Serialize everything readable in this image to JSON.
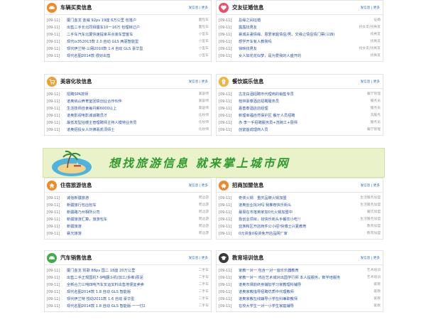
{
  "more_label": "发信息 | 更多",
  "panels": {
    "cars": {
      "title": "车辆买卖信息",
      "items": [
        {
          "date": "[09-11]",
          "title": "厦门金龙 金威 92ps 19座 6万公里 包落户",
          "tag": "面包车"
        },
        {
          "date": "[09-11]",
          "title": "出售二手长北同拜疆车10一16万 包理转过户",
          "tag": "面包车"
        },
        {
          "date": "[09-11]",
          "title": "二手车汽车北厦快速提拿吊点装车营客车",
          "tag": "小型车"
        },
        {
          "date": "[09-11]",
          "title": "现代ix352013款 2.0 自动 GLS 两驱智能型",
          "tag": "小型车"
        },
        {
          "date": "[09-11]",
          "title": "现代伊兰特-三厢2010款 1.4 自动 GLS 豪华型",
          "tag": "小型车"
        },
        {
          "date": "[09-11]",
          "title": "现代名图2014款 很好出售",
          "tag": "小型车"
        }
      ]
    },
    "dating": {
      "title": "交友征婚信息",
      "items": [
        {
          "date": "[09-11]",
          "title": "总缘之间征婚",
          "tag": "征婚"
        },
        {
          "date": "[09-11]",
          "title": "露露找男友",
          "tag": "找女友/找男友"
        },
        {
          "date": "[09-11]",
          "title": "襄城夫妻情缘、恩爱家庭情侣/男、交缘让情侣情门票(三四)",
          "tag": "找男友"
        },
        {
          "date": "[09-11]",
          "title": "想学开车有人教我吗",
          "tag": "找男友"
        },
        {
          "date": "[09-11]",
          "title": "徐映找男友",
          "tag": "找女友/找男友"
        },
        {
          "date": "[09-11]",
          "title": "女人如花花似梦，是为爱我的人盛开的",
          "tag": "找男友"
        }
      ]
    },
    "beauty": {
      "title": "美容化妆信息",
      "items": [
        {
          "date": "[09-11]",
          "title": "招聘SPA技师",
          "tag": "美容师"
        },
        {
          "date": "[09-11]",
          "title": "道奥纳山养育室回馈创业合作伙伴",
          "tag": "美容师"
        },
        {
          "date": "[09-11]",
          "title": "生活技师自食每月薪6000以上",
          "tag": "美容师"
        },
        {
          "date": "[09-11]",
          "title": "道奥影视电影城诚聘员才",
          "tag": "化妆师"
        },
        {
          "date": "[09-11]",
          "title": "最低发型拍楼主管理聘师主持人模特业务员",
          "tag": "化妆师"
        },
        {
          "date": "[09-11]",
          "title": "道奥招投女人刘佛翡凯须师士",
          "tag": "化妆师"
        }
      ]
    },
    "food": {
      "title": "餐饮娱乐信息",
      "items": [
        {
          "date": "[09-11]",
          "title": "古龙白酒招聘市代理商的销售专员",
          "tag": "餐厅管理"
        },
        {
          "date": "[09-11]",
          "title": "桂林豪泰酒店招聘服务员",
          "tag": "服务员"
        },
        {
          "date": "[09-11]",
          "title": "嘉善泰酒店店经理",
          "tag": "服务员"
        },
        {
          "date": "[09-11]",
          "title": "新理幸福自然保护区 餐厅人员招聘",
          "tag": "洗服务"
        },
        {
          "date": "[09-11]",
          "title": "赤·李一手招聘服务员+洗碗工+厨师",
          "tag": "服务员"
        },
        {
          "date": "[09-11]",
          "title": "创富首成理商人员",
          "tag": "餐厅管理"
        }
      ]
    },
    "travel": {
      "title": "住宿旅游信息",
      "items": [
        {
          "date": "[09-11]",
          "title": "诚信新疆旅游",
          "tag": "周边游"
        },
        {
          "date": "[09-11]",
          "title": "新疆旅行包凶包车",
          "tag": "周边游"
        },
        {
          "date": "[09-11]",
          "title": "新疆路乃州相所公司",
          "tag": "周边游"
        },
        {
          "date": "[09-11]",
          "title": "新疆旅游汇算，旅游包车",
          "tag": "周边游"
        },
        {
          "date": "[09-11]",
          "title": "新疆旅游",
          "tag": "周边游"
        },
        {
          "date": "[09-11]",
          "title": "襄光旅游",
          "tag": "周边游"
        }
      ]
    },
    "franchise": {
      "title": "招商加盟信息",
      "items": [
        {
          "date": "[09-11]",
          "title": "奇侠火锅　重庆品牌火锅加盟",
          "tag": "生活服务加盟"
        },
        {
          "date": "[09-11]",
          "title": "道奥创业找对吗 我推荐快乐街头",
          "tag": "生活服务加盟"
        },
        {
          "date": "[09-11]",
          "title": "最易在市落英家加0元火锅加盟中",
          "tag": "餐饮加盟"
        },
        {
          "date": "[09-11]",
          "title": "靠创业项目，找快乐街头手餐饮小吃!!",
          "tag": "生活服务加盟"
        },
        {
          "date": "[09-11]",
          "title": "亚族和区开店商件公小招!快博士兴夏教育",
          "tag": "教育加盟"
        },
        {
          "date": "[09-11]",
          "title": "0元资金0投资免开店品网厂家",
          "tag": "教育加盟"
        }
      ]
    },
    "autosale": {
      "title": "汽车销售信息",
      "items": [
        {
          "date": "[09-11]",
          "title": "厦门金龙 凯歌 88ps 国二 18座 20万公里",
          "tag": "二手车"
        },
        {
          "date": "[09-11]",
          "title": "出售二手正规国机7-9吨翻斗机(加工/多维)原泥",
          "tag": "二手车"
        },
        {
          "date": "[09-11]",
          "title": "全新合力三吨四吨汽车叉运叉料出售地便宜卖卖",
          "tag": "二手车"
        },
        {
          "date": "[09-11]",
          "title": "现代名图2014款 1.8 自动 GLS 智能版",
          "tag": "二手车"
        },
        {
          "date": "[09-11]",
          "title": "现代伊兰特 悦动2011款 1.6 自动 豪华型",
          "tag": "二手车"
        },
        {
          "date": "[09-11]",
          "title": "现代名图2014款 1.8 自动 GLS 智能版·一一付2",
          "tag": "二手车"
        }
      ]
    },
    "education": {
      "title": "教育培训信息",
      "items": [
        {
          "date": "[09-11]",
          "title": "家教一对一 包含一对一音乐乐器教育",
          "tag": "艺术培训"
        },
        {
          "date": "[09-11]",
          "title": "家教一对一 鸡在艺术城对出国学行师 本人提服务，数学培服务",
          "tag": "艺术培训"
        },
        {
          "date": "[09-11]",
          "title": "道奥市课前终身辅加学习家教理科辅导",
          "tag": "家教"
        },
        {
          "date": "[09-11]",
          "title": "道奥家教指导招聘优质中代理教师",
          "tag": "家教"
        },
        {
          "date": "[09-11]",
          "title": "道奥家教在线辅导小学在科兼职教师",
          "tag": "家教"
        },
        {
          "date": "[09-11]",
          "title": "在校大学生一对一小学生家庭辅导",
          "tag": "家教"
        }
      ]
    }
  },
  "banner": {
    "slogan": "想找旅游信息 就来掌上城市网"
  },
  "colors": {
    "cars": "#f08a24",
    "dating": "#e94e6b",
    "beauty": "#f0a030",
    "food": "#f2b43a",
    "travel": "#f28a24",
    "franchise": "#f0882a",
    "autosale": "#3fae49",
    "education": "#3a3a3a"
  },
  "icons": {
    "cars": "car-icon",
    "dating": "heart-icon",
    "beauty": "cart-icon",
    "food": "chef-icon",
    "travel": "house-icon",
    "franchise": "pig-bank-icon",
    "autosale": "car-icon",
    "education": "graduation-cap-icon"
  }
}
